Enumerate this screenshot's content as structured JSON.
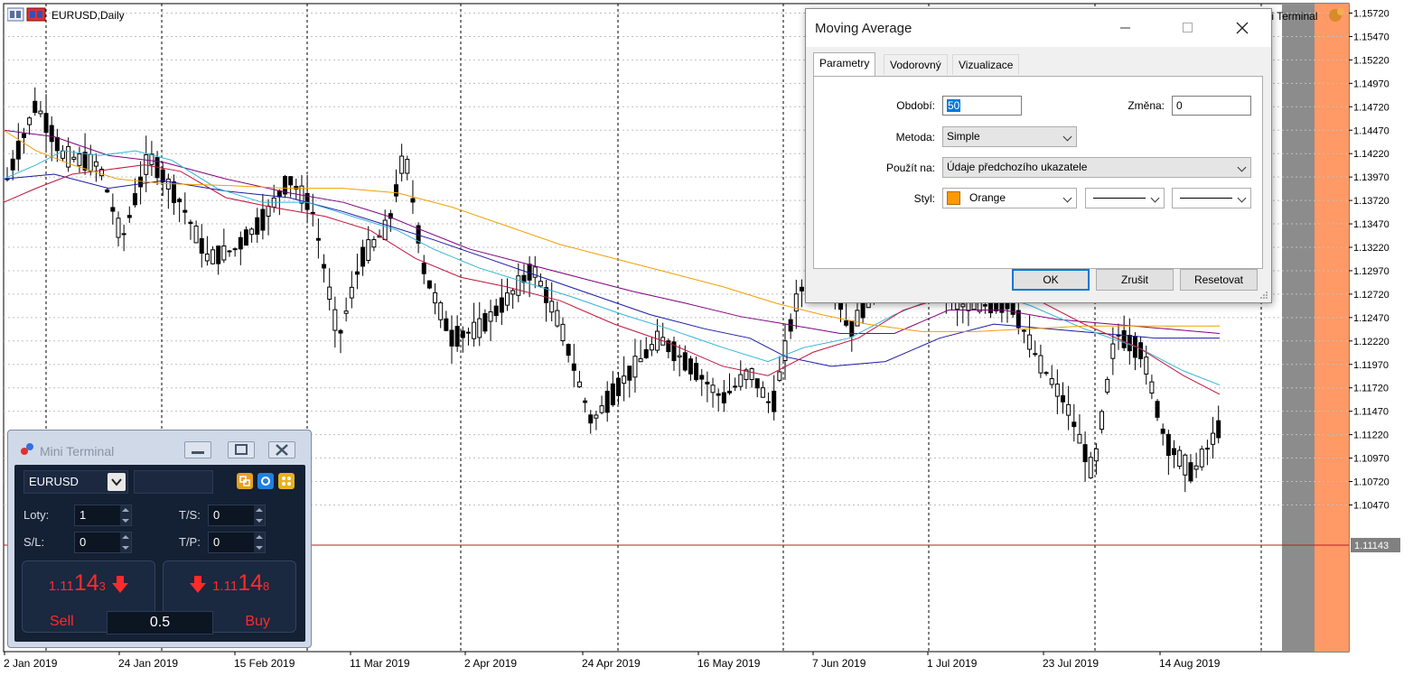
{
  "chart": {
    "title": "EURUSD,Daily",
    "current_price": "1.11143",
    "price_labels": [
      "1.15720",
      "1.15470",
      "1.15220",
      "1.14970",
      "1.14720",
      "1.14470",
      "1.14220",
      "1.13970",
      "1.13720",
      "1.13470",
      "1.13220",
      "1.12970",
      "1.12720",
      "1.12470",
      "1.12220",
      "1.11970",
      "1.11720",
      "1.11470",
      "1.11220",
      "1.10970",
      "1.10720",
      "1.10470"
    ],
    "date_labels": [
      "2 Jan 2019",
      "24 Jan 2019",
      "15 Feb 2019",
      "11 Mar 2019",
      "2 Apr 2019",
      "24 Apr 2019",
      "16 May 2019",
      "7 Jun 2019",
      "1 Jul 2019",
      "23 Jul 2019",
      "14 Aug 2019"
    ],
    "colors": {
      "grid": "#c0c0c0",
      "candle": "#000000",
      "price_line": "#b22222",
      "ma_purple": "#800080",
      "ma_blue": "#1a1aa6",
      "ma_cyan": "#33b5d6",
      "ma_red": "#c0143c",
      "ma_orange": "#f0a000",
      "future_gray": "#8c8c8c",
      "future_orange": "#ff9966"
    },
    "top_right_label": "Mini Terminal"
  },
  "dialog": {
    "title": "Moving Average",
    "tabs": [
      "Parametry",
      "Vodorovný",
      "Vizualizace"
    ],
    "period_label": "Období:",
    "period_value": "50",
    "shift_label": "Změna:",
    "shift_value": "0",
    "method_label": "Metoda:",
    "method_value": "Simple",
    "apply_label": "Použít na:",
    "apply_value": "Údaje předchozího ukazatele",
    "style_label": "Styl:",
    "style_color_name": "Orange",
    "style_color": "#ff9900",
    "ok_label": "OK",
    "cancel_label": "Zrušit",
    "reset_label": "Resetovat"
  },
  "mini_terminal": {
    "title": "Mini Terminal",
    "symbol": "EURUSD",
    "lots_label": "Loty:",
    "lots_value": "1",
    "ts_label": "T/S:",
    "ts_value": "0",
    "sl_label": "S/L:",
    "sl_value": "0",
    "tp_label": "T/P:",
    "tp_value": "0",
    "sell_price_prefix": "1.11",
    "sell_price_big": "14",
    "sell_price_sup": "3",
    "buy_price_prefix": "1.11",
    "buy_price_big": "14",
    "buy_price_sup": "8",
    "sell_label": "Sell",
    "buy_label": "Buy",
    "volume": "0.5"
  }
}
